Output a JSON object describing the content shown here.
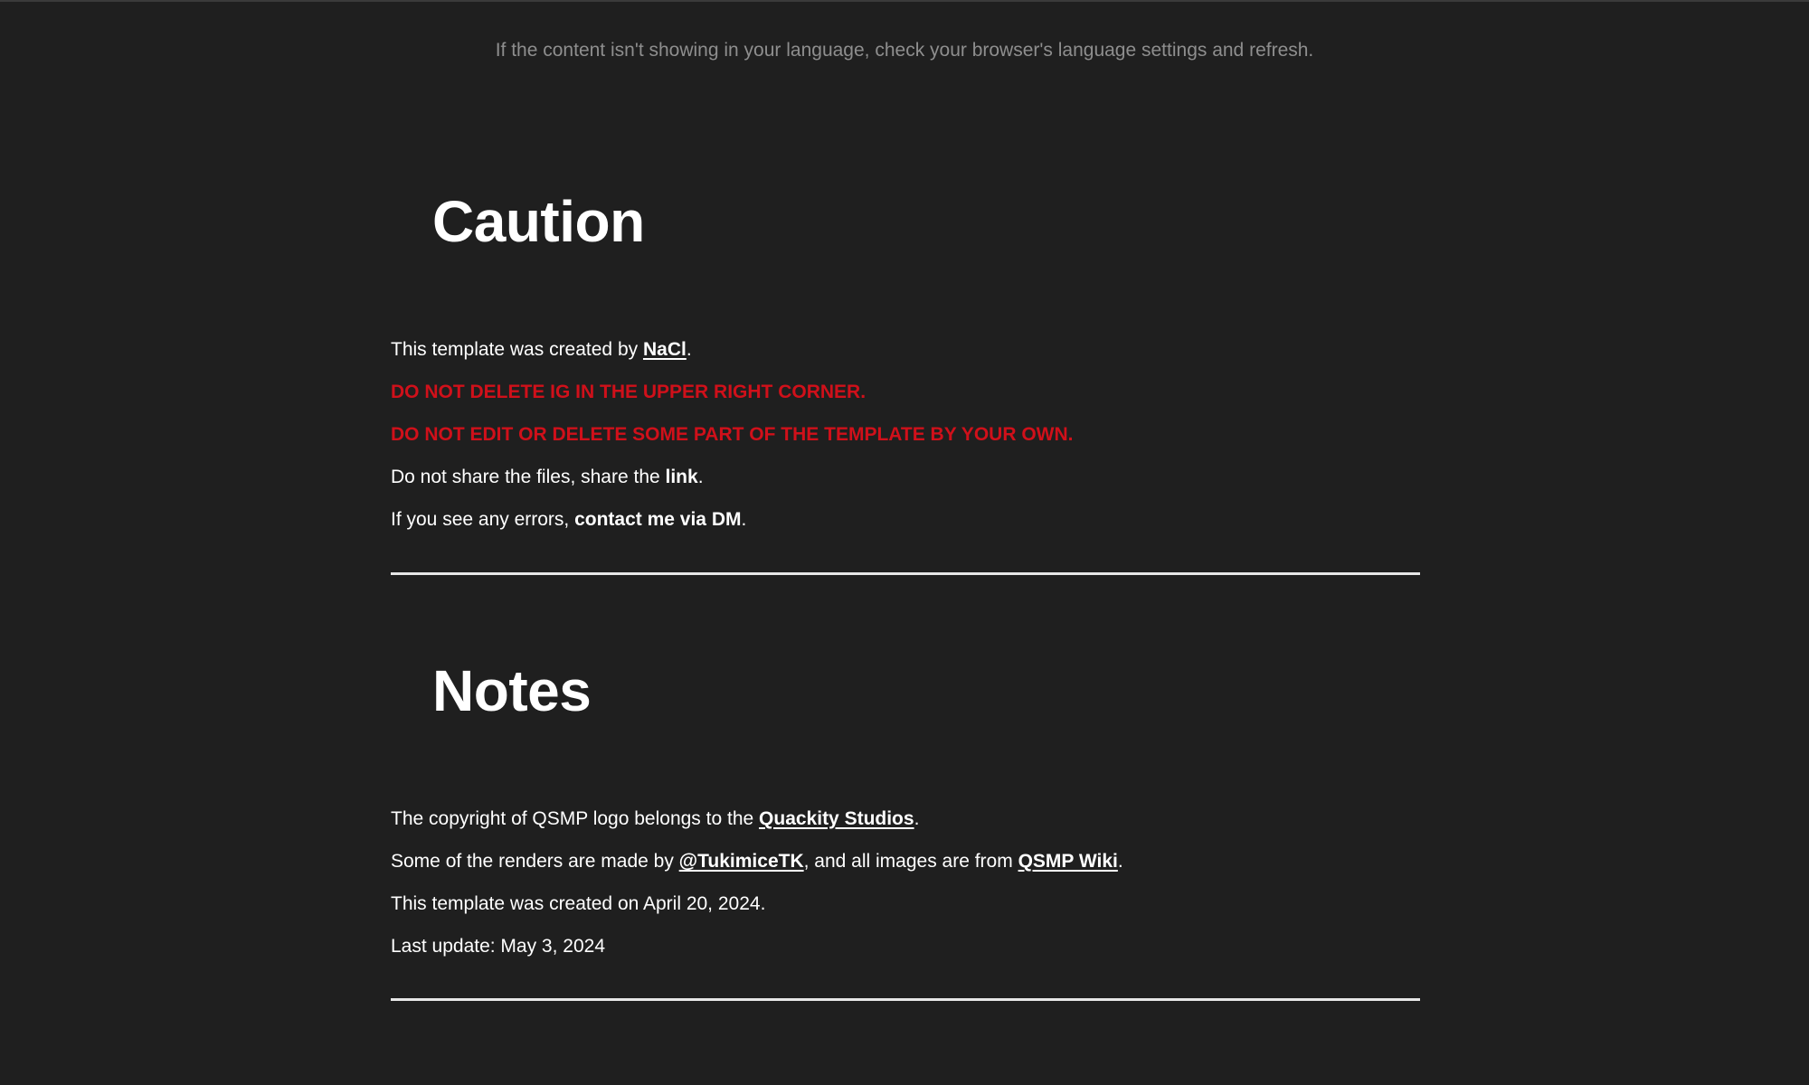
{
  "header": {
    "language_note": "If the content isn't showing in your language, check your browser's language settings and refresh."
  },
  "caution": {
    "title": "Caution",
    "created_by_prefix": "This template was created by ",
    "creator_link": "NaCl",
    "created_by_suffix": ".",
    "warning_1": "DO NOT DELETE IG IN THE UPPER RIGHT CORNER.",
    "warning_2": "DO NOT EDIT OR DELETE SOME PART OF THE TEMPLATE BY YOUR OWN.",
    "share_prefix": "Do not share the files, share the ",
    "share_bold": "link",
    "share_suffix": ".",
    "errors_prefix": "If you see any errors, ",
    "errors_bold": "contact me via DM",
    "errors_suffix": "."
  },
  "notes": {
    "title": "Notes",
    "copyright_prefix": "The copyright of QSMP logo belongs to the ",
    "copyright_link": "Quackity Studios",
    "copyright_suffix": ".",
    "renders_prefix": "Some of the renders are made by ",
    "renders_link": "@TukimiceTK",
    "renders_middle": ", and all images are from ",
    "wiki_link": "QSMP Wiki",
    "renders_suffix": ".",
    "created_on": "This template was created on April 20, 2024.",
    "last_update": "Last update: May 3, 2024"
  },
  "colors": {
    "background": "#1f1f1f",
    "text": "#ffffff",
    "muted": "#8e8e8e",
    "warning": "#d0101a"
  }
}
